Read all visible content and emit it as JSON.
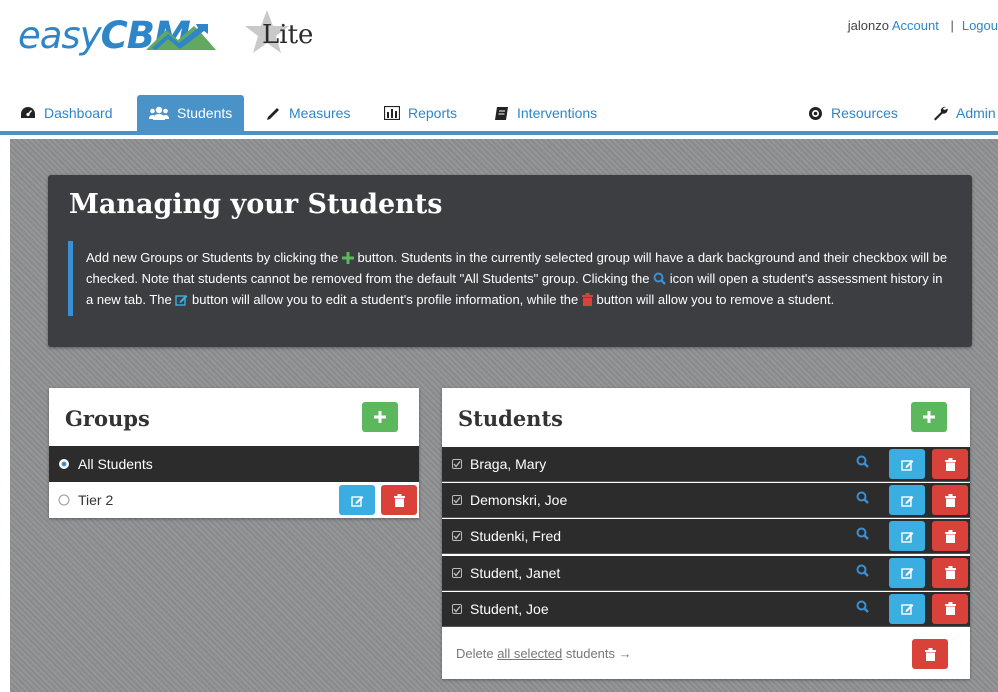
{
  "header": {
    "logo_easy": "easy",
    "logo_cbm": "CBM",
    "logo_dot": ".",
    "lite_label": "Lite",
    "username": "jalonzo",
    "account_link": "Account",
    "separator": "|",
    "logout_link": "Logou"
  },
  "nav": {
    "dashboard": "Dashboard",
    "students": "Students",
    "measures": "Measures",
    "reports": "Reports",
    "interventions": "Interventions",
    "resources": "Resources",
    "admin": "Admin"
  },
  "intro": {
    "title": "Managing your Students",
    "text_1": "Add new Groups or Students by clicking the",
    "text_2": "button. Students in the currently selected group will have a dark background and their checkbox will be checked. Note that students cannot be removed from the default \"All Students\" group. Clicking the",
    "text_3": "icon will open a student's assessment history in a new tab. The",
    "text_4": "button will allow you to edit a student's profile information, while the",
    "text_5": "button will allow you to remove a student."
  },
  "groups": {
    "title": "Groups",
    "items": [
      {
        "label": "All Students",
        "selected": true
      },
      {
        "label": "Tier 2",
        "selected": false
      }
    ]
  },
  "students": {
    "title": "Students",
    "items": [
      {
        "name": "Braga, Mary"
      },
      {
        "name": "Demonskri, Joe"
      },
      {
        "name": "Studenki, Fred"
      },
      {
        "name": "Student, Janet"
      },
      {
        "name": "Student, Joe"
      }
    ],
    "footer_prefix": "Delete",
    "footer_link": "all selected",
    "footer_suffix": "students →"
  },
  "colors": {
    "brand_blue": "#2e85c8",
    "nav_active": "#4a93c9",
    "add_green": "#5cb85c",
    "edit_blue": "#3aaee0",
    "delete_red": "#d9413b",
    "row_dark": "#2c2c2c"
  },
  "icons": {
    "dashboard": "dashboard-gauge-icon",
    "students": "users-icon",
    "measures": "pencil-icon",
    "reports": "bar-chart-icon",
    "interventions": "book-icon",
    "resources": "compass-icon",
    "admin": "wrench-icon",
    "add": "plus-icon",
    "search": "search-icon",
    "edit": "edit-icon",
    "delete": "trash-icon",
    "checkbox": "checkbox-checked-icon",
    "radio": "radio-icon"
  }
}
